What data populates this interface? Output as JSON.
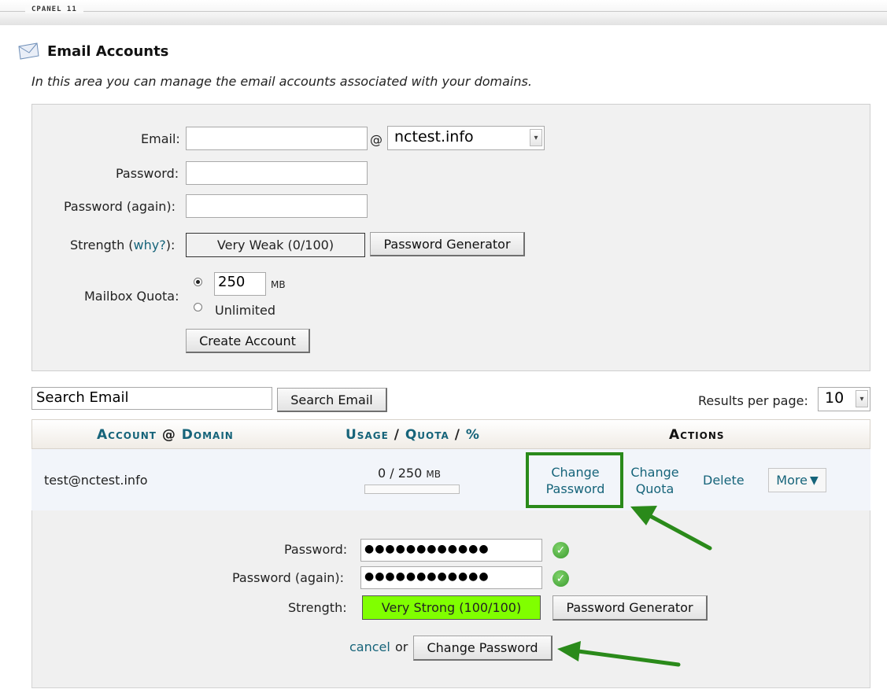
{
  "header": {
    "brand": "CPANEL 11"
  },
  "page": {
    "title": "Email Accounts",
    "intro": "In this area you can manage the email accounts associated with your domains."
  },
  "create_form": {
    "email_label": "Email:",
    "email_value": "",
    "at_sign": "@",
    "domain_selected": "nctest.info",
    "password_label": "Password:",
    "password_again_label": "Password (again):",
    "strength_label_prefix": "Strength (",
    "strength_why": "why?",
    "strength_label_suffix": "):",
    "strength_value": "Very Weak (0/100)",
    "password_generator": "Password Generator",
    "quota_label": "Mailbox Quota:",
    "quota_value": "250",
    "quota_unit": "MB",
    "quota_unlimited": "Unlimited",
    "create_button": "Create Account"
  },
  "search": {
    "input_value": "Search Email",
    "button": "Search Email",
    "results_label": "Results per page:",
    "results_selected": "10"
  },
  "table": {
    "col_account": "Account",
    "col_at": "@",
    "col_domain": "Domain",
    "col_usage": "Usage",
    "col_sep1": "/",
    "col_quota": "Quota",
    "col_sep2": "/",
    "col_percent": "%",
    "col_actions": "Actions",
    "rows": [
      {
        "account": "test@nctest.info",
        "usage": "0 / 250",
        "usage_unit": "MB",
        "usage_fraction": 0,
        "action_change_password_1": "Change",
        "action_change_password_2": "Password",
        "action_change_quota_1": "Change",
        "action_change_quota_2": "Quota",
        "action_delete": "Delete",
        "action_more": "More"
      }
    ]
  },
  "change_password_form": {
    "password_label": "Password:",
    "password_masked": "●●●●●●●●●●●●",
    "password_again_label": "Password (again):",
    "password_again_masked": "●●●●●●●●●●●●",
    "strength_label": "Strength:",
    "strength_value": "Very Strong (100/100)",
    "password_generator": "Password Generator",
    "cancel": "cancel",
    "or": "or",
    "submit": "Change Password"
  },
  "colors": {
    "link": "#16647a",
    "highlight_box": "#2a8a1a",
    "strong_fill": "#80ff00",
    "arrow": "#2a8a1a"
  }
}
